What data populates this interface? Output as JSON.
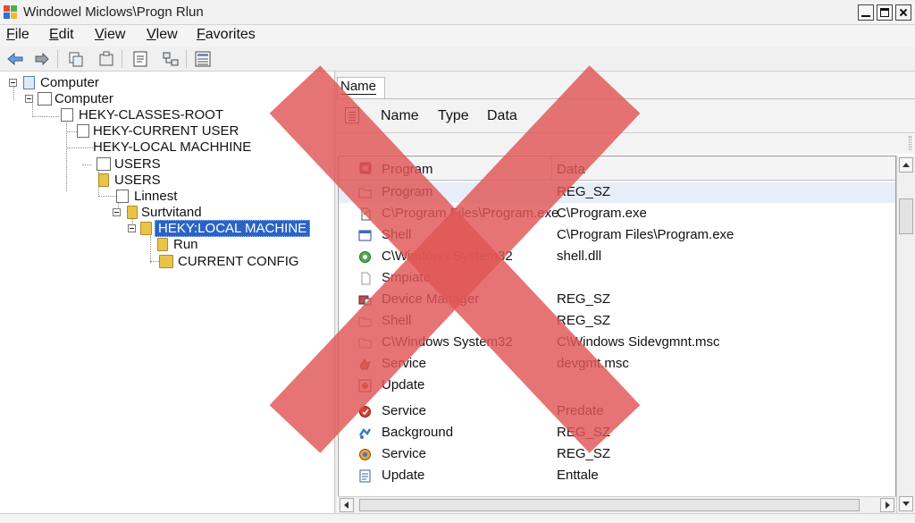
{
  "window": {
    "title": "Windowel Miclows\\Progn Rlun"
  },
  "menu": [
    "File",
    "Edit",
    "View",
    "Vlew",
    "Favorites"
  ],
  "toolbar": {
    "icons": [
      "back-arrow-icon",
      "forward-icon",
      "copy-icon",
      "paste-icon",
      "properties-icon",
      "network-icon",
      "list-icon"
    ]
  },
  "tree": {
    "nodes": [
      {
        "label": "Computer",
        "icon": "computer-folder-icon"
      },
      {
        "label": "Computer",
        "icon": "folder-icon"
      },
      {
        "label": "HEKY-CLASSES-ROOT",
        "icon": "registry-key-icon"
      },
      {
        "label": "HEKY-CURRENT USER",
        "icon": "registry-key-icon"
      },
      {
        "label": "HEKY-LOCAL MACHHINE",
        "icon": ""
      },
      {
        "label": "USERS",
        "icon": "folder-icon"
      },
      {
        "label": "USERS",
        "icon": "folder-icon"
      },
      {
        "label": "Linnest",
        "icon": "folder-icon"
      },
      {
        "label": "Surtvitand",
        "icon": "folder-icon"
      },
      {
        "label": "HEKY:LOCAL MACHINE",
        "icon": "folder-icon",
        "selected": true
      },
      {
        "label": "Run",
        "icon": "folder-icon"
      },
      {
        "label": "CURRENT CONFIG",
        "icon": "config-icon"
      }
    ]
  },
  "right_header": {
    "tab": "Name",
    "columns": [
      "Name",
      "Type",
      "Data"
    ]
  },
  "list": {
    "headers": [
      "Program",
      "Data"
    ],
    "rows": [
      {
        "name": "Program",
        "data": "REG_SZ",
        "icon": "folder-icon",
        "selected": true
      },
      {
        "name": "C\\Program Files\\Program.exe",
        "data": "C\\Program.exe",
        "icon": "document-icon"
      },
      {
        "name": "Shell",
        "data": "C\\Program Files\\Program.exe",
        "icon": "window-icon"
      },
      {
        "name": "C\\Windows System32",
        "data": "shell.dll",
        "icon": "gear-icon"
      },
      {
        "name": "Smpiate",
        "data": "",
        "icon": "document-icon"
      },
      {
        "name": "Device Manager",
        "data": "REG_SZ",
        "icon": "device-manager-icon"
      },
      {
        "name": "Shell",
        "data": "REG_SZ",
        "icon": "folder-icon"
      },
      {
        "name": "C\\Windows System32",
        "data": "C\\Windows Sidevgmnt.msc",
        "icon": "folder-icon"
      },
      {
        "name": "Service",
        "data": "devgmt.msc",
        "icon": "service-icon"
      },
      {
        "name": "Update",
        "data": "",
        "icon": "update-icon"
      },
      {
        "name": "Service",
        "data": "Predate",
        "icon": "service-icon"
      },
      {
        "name": "Background",
        "data": "REG_SZ",
        "icon": "background-icon"
      },
      {
        "name": "Service",
        "data": "REG_SZ",
        "icon": "service-icon"
      },
      {
        "name": "Update",
        "data": "Enttale",
        "icon": "update-icon"
      }
    ]
  },
  "colors": {
    "selection": "#2a63c5",
    "overlay_x": "#e05656"
  }
}
